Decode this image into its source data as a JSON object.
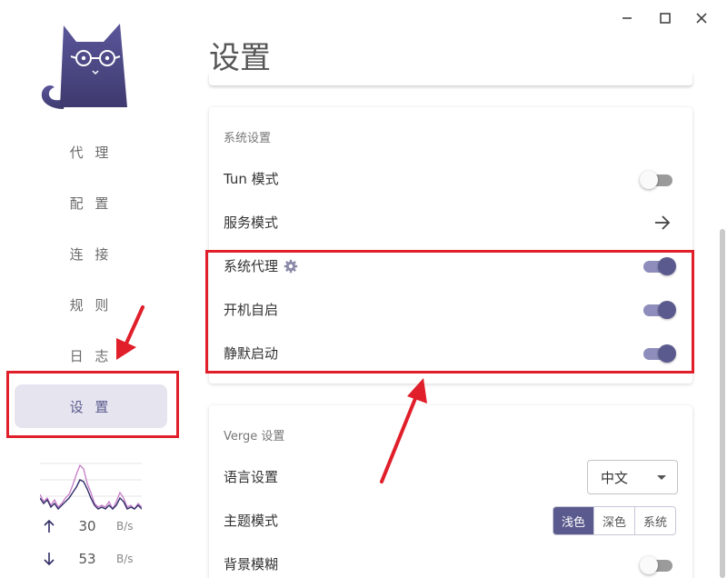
{
  "window": {
    "minimize_icon": "minimize-icon",
    "maximize_icon": "maximize-icon",
    "close_icon": "close-icon"
  },
  "sidebar": {
    "logo": "cat-logo",
    "items": [
      {
        "label": "代 理",
        "active": false
      },
      {
        "label": "配 置",
        "active": false
      },
      {
        "label": "连 接",
        "active": false
      },
      {
        "label": "规 则",
        "active": false
      },
      {
        "label": "日 志",
        "active": false
      },
      {
        "label": "设 置",
        "active": true
      }
    ],
    "traffic": {
      "upload": {
        "value": "30",
        "unit": "B/s",
        "icon": "arrow-up-icon"
      },
      "download": {
        "value": "53",
        "unit": "B/s",
        "icon": "arrow-down-icon"
      }
    }
  },
  "page": {
    "title": "设置"
  },
  "system_settings": {
    "title": "系统设置",
    "rows": {
      "tun": {
        "label": "Tun 模式",
        "on": false
      },
      "service": {
        "label": "服务模式",
        "icon": "arrow-right-icon"
      },
      "proxy": {
        "label": "系统代理",
        "icon": "gear-icon",
        "on": true
      },
      "autostart": {
        "label": "开机自启",
        "on": true
      },
      "silent": {
        "label": "静默启动",
        "on": true
      }
    }
  },
  "verge_settings": {
    "title": "Verge 设置",
    "language": {
      "label": "语言设置",
      "value": "中文"
    },
    "theme": {
      "label": "主题模式",
      "options": [
        "浅色",
        "深色",
        "系统"
      ],
      "selected": "浅色"
    },
    "blur": {
      "label": "背景模糊",
      "on": false
    }
  },
  "colors": {
    "accent": "#5b5a8e",
    "highlight": "#e01f2a"
  }
}
